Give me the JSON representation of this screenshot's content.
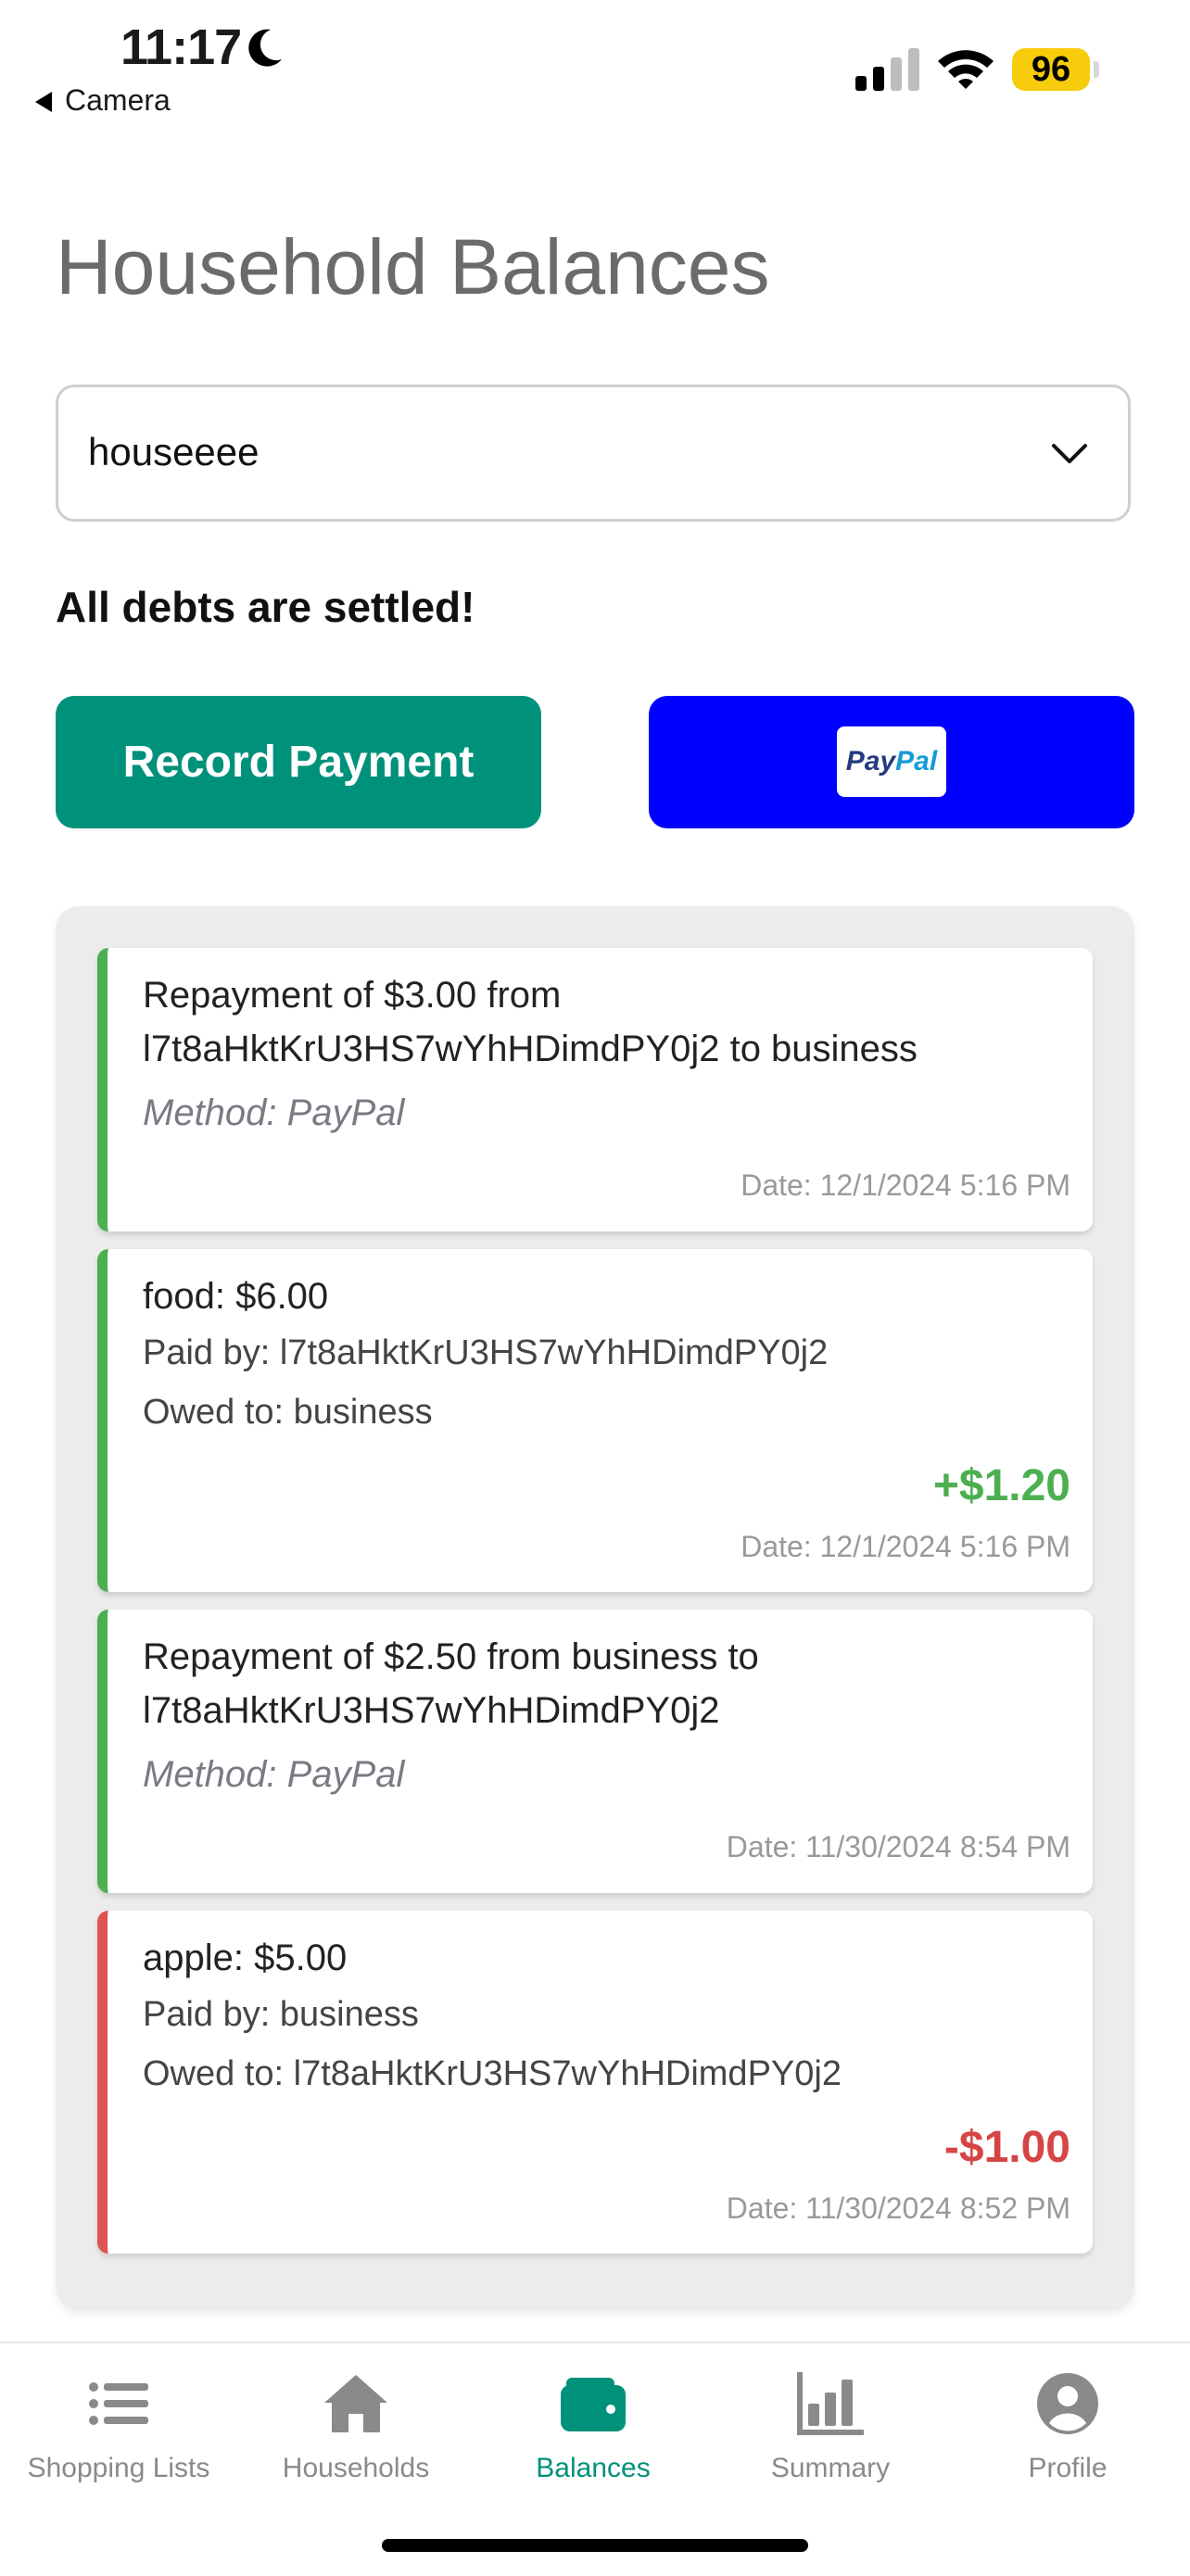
{
  "status_bar": {
    "time": "11:17",
    "back_label": "Camera",
    "battery": "96"
  },
  "page": {
    "title": "Household Balances",
    "household_select": "houseeee",
    "settled_message": "All debts are settled!",
    "record_payment_label": "Record Payment",
    "paypal_logo_text_1": "Pay",
    "paypal_logo_text_2": "Pal"
  },
  "transactions": [
    {
      "title": "Repayment of $3.00 from l7t8aHktKrU3HS7wYhHDimdPY0j2 to business",
      "method": "Method: PayPal",
      "date": "Date: 12/1/2024 5:16 PM",
      "status": "green"
    },
    {
      "title": "food: $6.00",
      "paid_by": "Paid by: l7t8aHktKrU3HS7wYhHDimdPY0j2",
      "owed_to": "Owed to: business",
      "amount": "+$1.20",
      "date": "Date: 12/1/2024 5:16 PM",
      "status": "green"
    },
    {
      "title": "Repayment of $2.50 from business to l7t8aHktKrU3HS7wYhHDimdPY0j2",
      "method": "Method: PayPal",
      "date": "Date: 11/30/2024 8:54 PM",
      "status": "green"
    },
    {
      "title": "apple: $5.00",
      "paid_by": "Paid by: business",
      "owed_to": "Owed to: l7t8aHktKrU3HS7wYhHDimdPY0j2",
      "amount": "-$1.00",
      "date": "Date: 11/30/2024 8:52 PM",
      "status": "red"
    }
  ],
  "tabs": [
    {
      "label": "Shopping Lists",
      "icon": "list-icon"
    },
    {
      "label": "Households",
      "icon": "home-icon"
    },
    {
      "label": "Balances",
      "icon": "wallet-icon",
      "active": true
    },
    {
      "label": "Summary",
      "icon": "bar-chart-icon"
    },
    {
      "label": "Profile",
      "icon": "user-circle-icon"
    }
  ],
  "colors": {
    "accent": "#00917a",
    "paypal_button": "#0000fe",
    "positive": "#4caf50",
    "negative": "#d64545"
  }
}
